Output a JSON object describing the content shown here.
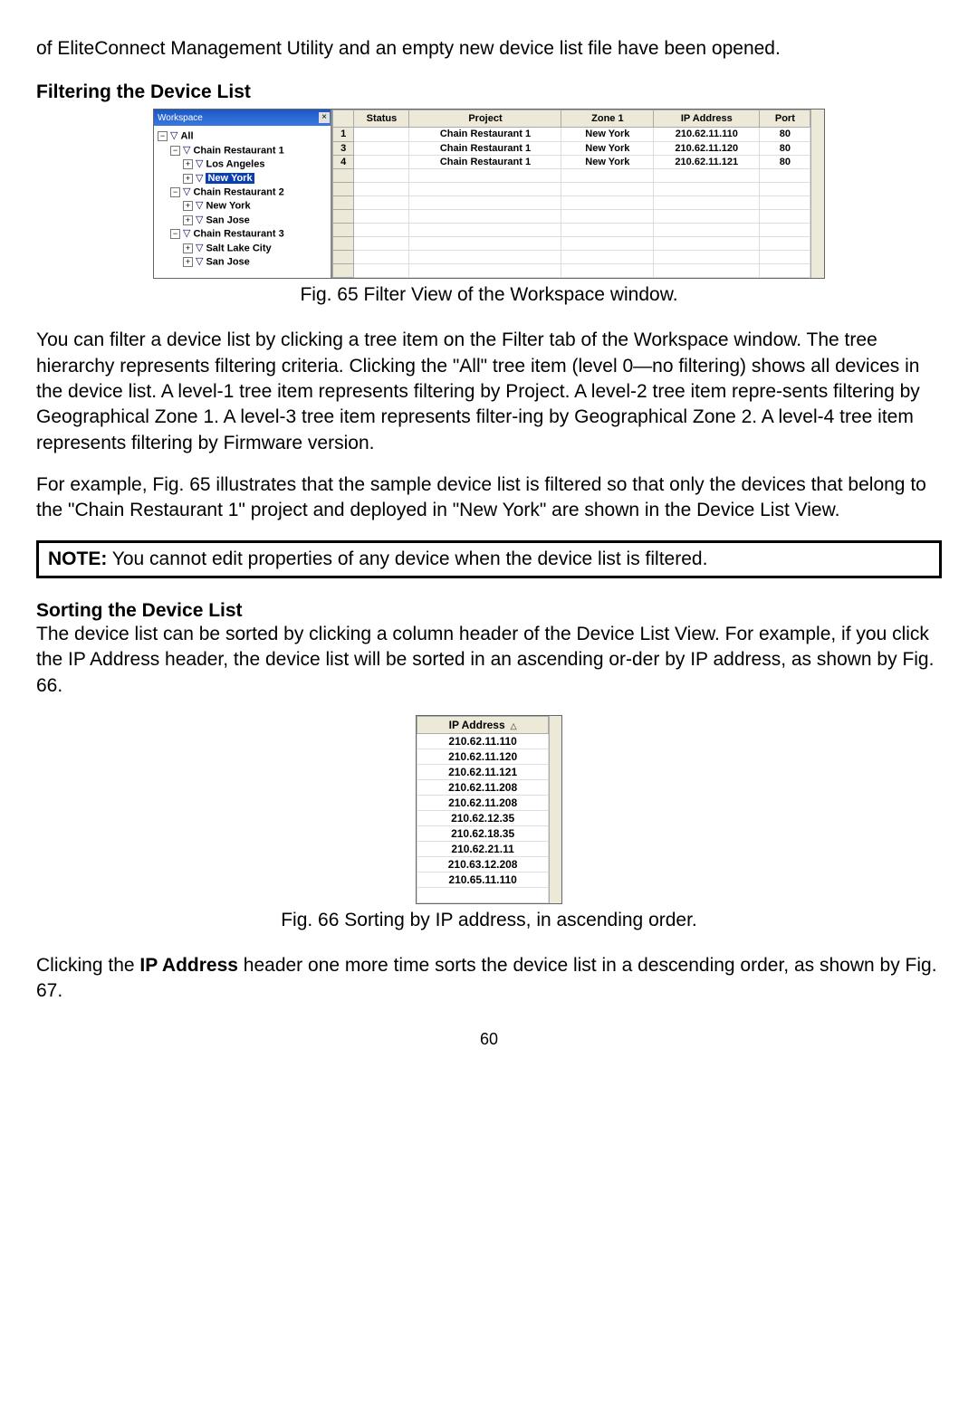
{
  "intro": "of EliteConnect Management Utility and an empty new device list file have been opened.",
  "heading_filter": "Filtering the Device List",
  "fig65": {
    "panel_title": "Workspace",
    "tree": {
      "all": "All",
      "cr1": "Chain Restaurant 1",
      "la": "Los Angeles",
      "ny": "New York",
      "cr2": "Chain Restaurant 2",
      "ny2": "New York",
      "sj": "San Jose",
      "cr3": "Chain Restaurant 3",
      "slc": "Salt Lake City",
      "sj2": "San Jose"
    },
    "columns": {
      "status": "Status",
      "project": "Project",
      "zone1": "Zone 1",
      "ip": "IP Address",
      "port": "Port"
    },
    "rows": [
      {
        "n": "1",
        "project": "Chain Restaurant 1",
        "zone1": "New York",
        "ip": "210.62.11.110",
        "port": "80"
      },
      {
        "n": "3",
        "project": "Chain Restaurant 1",
        "zone1": "New York",
        "ip": "210.62.11.120",
        "port": "80"
      },
      {
        "n": "4",
        "project": "Chain Restaurant 1",
        "zone1": "New York",
        "ip": "210.62.11.121",
        "port": "80"
      }
    ]
  },
  "fig65_caption": "Fig. 65 Filter View of the Workspace window.",
  "para_filter1": "You can filter a device list by clicking a tree item on the Filter tab of the Workspace window. The tree hierarchy represents filtering criteria. Clicking the \"All\" tree item (level 0—no filtering) shows all devices in the device list. A level-1 tree item represents filtering by Project. A level-2 tree item repre-sents filtering by Geographical Zone 1. A level-3 tree item represents filter-ing by Geographical Zone 2. A level-4 tree item represents filtering by Firmware version.",
  "para_filter2": "For example, Fig. 65 illustrates that the sample device list is filtered so that only the devices that belong to the \"Chain Restaurant 1\" project and deployed in \"New York\" are shown in the Device List View.",
  "note_bold": "NOTE:",
  "note_rest": " You cannot edit properties of any device when the device list is filtered.",
  "heading_sort": "Sorting the Device List",
  "para_sort1": "The device list can be sorted by clicking a column header of the Device List View. For example, if you click the IP Address header, the device list will be sorted in an ascending or-der by IP address, as shown by Fig. 66.",
  "fig66": {
    "header": "IP Address",
    "ips": [
      "210.62.11.110",
      "210.62.11.120",
      "210.62.11.121",
      "210.62.11.208",
      "210.62.11.208",
      "210.62.12.35",
      "210.62.18.35",
      "210.62.21.11",
      "210.63.12.208",
      "210.65.11.110"
    ]
  },
  "fig66_caption": "Fig. 66 Sorting by IP address, in ascending order.",
  "para_sort2a": "Clicking the ",
  "para_sort2_bold": "IP Address",
  "para_sort2b": " header one more time sorts the device list in a descending order, as shown by Fig. 67.",
  "pagenum": "60"
}
